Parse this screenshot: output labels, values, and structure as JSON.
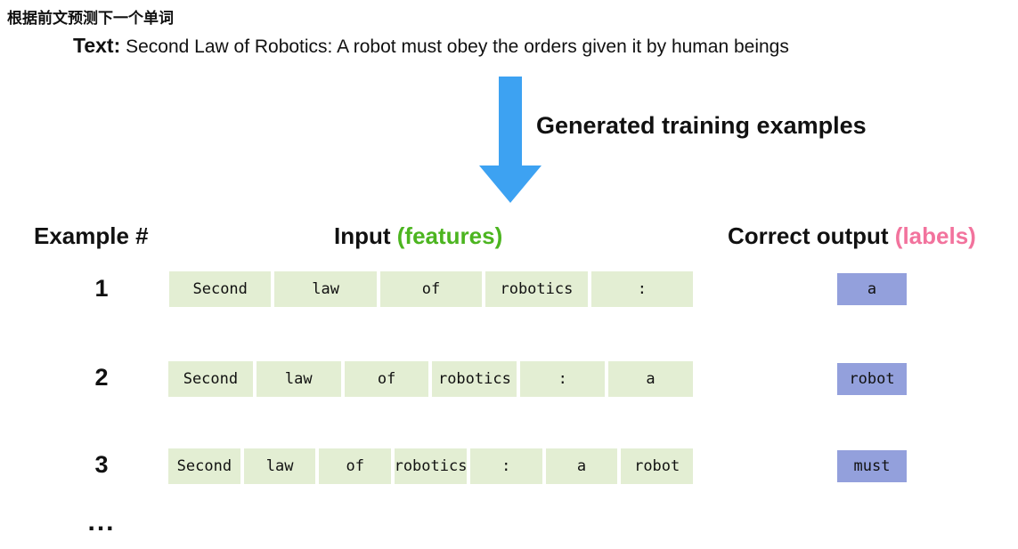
{
  "zh_title": "根据前文预测下一个单词",
  "text_line": {
    "label": "Text:",
    "body": "Second Law of Robotics: A robot must obey the orders given it by human beings"
  },
  "arrow": {
    "name": "down-arrow",
    "color": "#3DA2F2",
    "direction": "down"
  },
  "generated_label": "Generated training examples",
  "headers": {
    "example": "Example #",
    "input_main": "Input",
    "input_accent": "(features)",
    "output_main": "Correct output",
    "output_accent": "(labels)"
  },
  "colors": {
    "token_bg": "#E3EED3",
    "label_bg": "#93A0DC",
    "features_accent": "#4CB520",
    "labels_accent": "#F2739D",
    "arrow_blue": "#3DA2F2"
  },
  "rows": [
    {
      "number": "1",
      "tokens": [
        "Second",
        "law",
        "of",
        "robotics",
        ":"
      ],
      "label": "a"
    },
    {
      "number": "2",
      "tokens": [
        "Second",
        "law",
        "of",
        "robotics",
        ":",
        "a"
      ],
      "label": "robot"
    },
    {
      "number": "3",
      "tokens": [
        "Second",
        "law",
        "of",
        "robotics",
        ":",
        "a",
        "robot"
      ],
      "label": "must"
    }
  ],
  "ellipsis": "..."
}
